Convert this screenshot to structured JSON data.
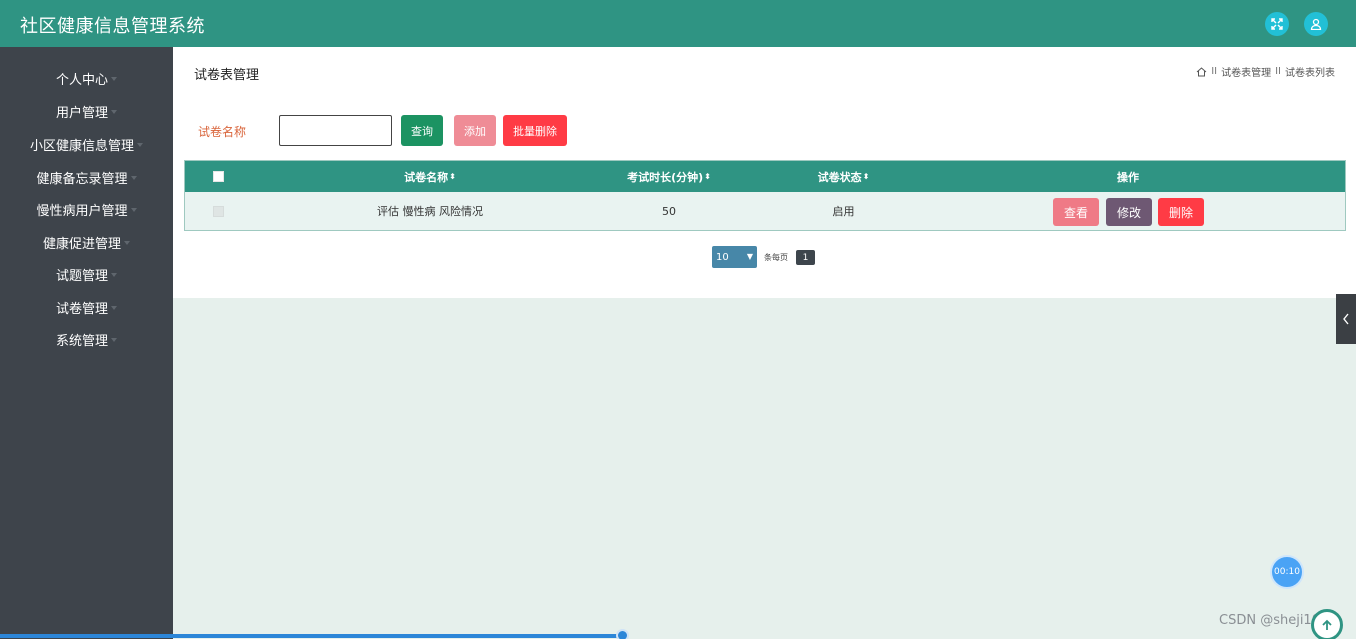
{
  "app": {
    "title": "社区健康信息管理系统"
  },
  "header_icons": [
    "fullscreen-icon",
    "user-icon"
  ],
  "sidebar": {
    "items": [
      {
        "label": "个人中心"
      },
      {
        "label": "用户管理"
      },
      {
        "label": "小区健康信息管理"
      },
      {
        "label": "健康备忘录管理"
      },
      {
        "label": "慢性病用户管理"
      },
      {
        "label": "健康促进管理"
      },
      {
        "label": "试题管理"
      },
      {
        "label": "试卷管理"
      },
      {
        "label": "系统管理"
      }
    ]
  },
  "page": {
    "title": "试卷表管理",
    "breadcrumb": [
      "试卷表管理",
      "试卷表列表"
    ]
  },
  "search": {
    "label": "试卷名称",
    "value": "",
    "query_label": "查询",
    "add_label": "添加",
    "batch_delete_label": "批量删除"
  },
  "table": {
    "columns": [
      "试卷名称",
      "考试时长(分钟)",
      "试卷状态",
      "操作"
    ],
    "rows": [
      {
        "name": "评估 慢性病 风险情况",
        "duration": "50",
        "status": "启用"
      }
    ],
    "actions": {
      "view": "查看",
      "edit": "修改",
      "delete": "删除"
    }
  },
  "pager": {
    "page_size": "10",
    "per_page_label": "条每页",
    "current_page": "1"
  },
  "timer": "00:10",
  "watermark": "CSDN @sheji1011",
  "colors": {
    "primary": "#2f9483",
    "sidebar": "#3e444b",
    "danger": "#ff3b45",
    "pink": "#ef8c96",
    "query": "#1c9362",
    "edit": "#6e5873",
    "accent": "#22c0d6"
  }
}
